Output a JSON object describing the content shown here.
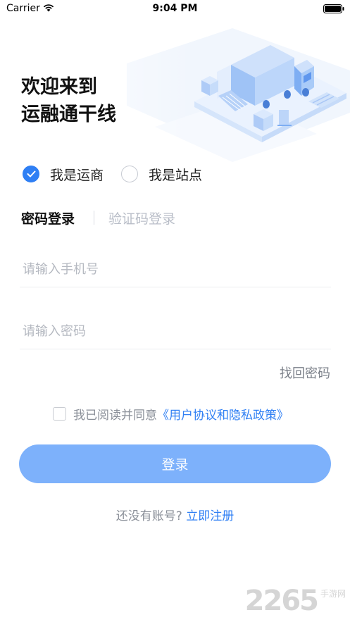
{
  "status_bar": {
    "carrier": "Carrier",
    "time": "9:04 PM"
  },
  "welcome": {
    "line1": "欢迎来到",
    "line2": "运融通干线"
  },
  "roles": {
    "option1": {
      "label": "我是运商",
      "selected": true
    },
    "option2": {
      "label": "我是站点",
      "selected": false
    }
  },
  "tabs": {
    "password_login": "密码登录",
    "code_login": "验证码登录"
  },
  "form": {
    "phone_placeholder": "请输入手机号",
    "password_placeholder": "请输入密码",
    "forgot_password": "找回密码"
  },
  "agreement": {
    "text": "我已阅读并同意",
    "link": "《用户协议和隐私政策》",
    "checked": false
  },
  "login_button": "登录",
  "register": {
    "text": "还没有账号?",
    "link": "立即注册"
  },
  "watermark": {
    "number": "2265",
    "sub": "手游网"
  },
  "colors": {
    "accent": "#2f7ff4",
    "button": "#7db1fb",
    "muted_text": "#8a8f98",
    "placeholder": "#b5b9c1"
  }
}
